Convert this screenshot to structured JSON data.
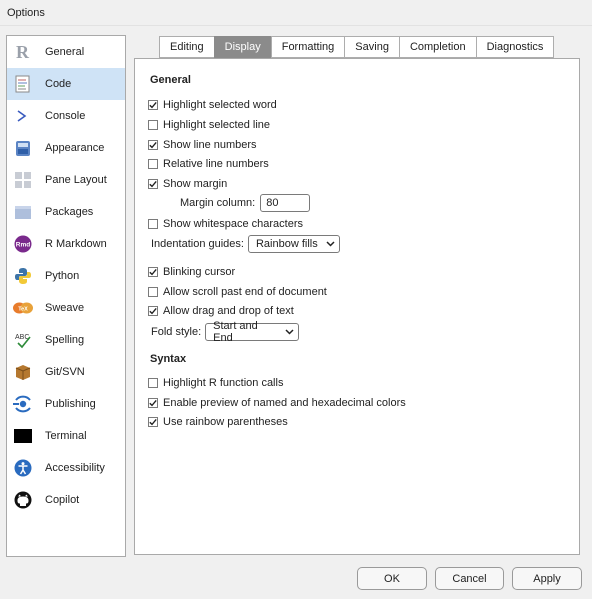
{
  "window": {
    "title": "Options"
  },
  "sidebar": {
    "items": [
      {
        "label": "General",
        "icon": "r-logo-icon"
      },
      {
        "label": "Code",
        "icon": "code-document-icon",
        "active": true
      },
      {
        "label": "Console",
        "icon": "console-prompt-icon"
      },
      {
        "label": "Appearance",
        "icon": "appearance-paint-icon"
      },
      {
        "label": "Pane Layout",
        "icon": "pane-layout-icon"
      },
      {
        "label": "Packages",
        "icon": "packages-box-icon"
      },
      {
        "label": "R Markdown",
        "icon": "rmarkdown-icon"
      },
      {
        "label": "Python",
        "icon": "python-logo-icon"
      },
      {
        "label": "Sweave",
        "icon": "sweave-tex-icon"
      },
      {
        "label": "Spelling",
        "icon": "spelling-abc-icon"
      },
      {
        "label": "Git/SVN",
        "icon": "git-box-icon"
      },
      {
        "label": "Publishing",
        "icon": "publishing-icon"
      },
      {
        "label": "Terminal",
        "icon": "terminal-icon"
      },
      {
        "label": "Accessibility",
        "icon": "accessibility-icon"
      },
      {
        "label": "Copilot",
        "icon": "github-copilot-icon"
      }
    ]
  },
  "tabs": [
    {
      "label": "Editing"
    },
    {
      "label": "Display",
      "active": true
    },
    {
      "label": "Formatting"
    },
    {
      "label": "Saving"
    },
    {
      "label": "Completion"
    },
    {
      "label": "Diagnostics"
    }
  ],
  "general": {
    "heading": "General",
    "highlight_word": {
      "label": "Highlight selected word",
      "checked": true
    },
    "highlight_line": {
      "label": "Highlight selected line",
      "checked": false
    },
    "show_line_numbers": {
      "label": "Show line numbers",
      "checked": true
    },
    "relative_line_numbers": {
      "label": "Relative line numbers",
      "checked": false
    },
    "show_margin": {
      "label": "Show margin",
      "checked": true
    },
    "margin_column": {
      "label": "Margin column:",
      "value": "80"
    },
    "show_whitespace": {
      "label": "Show whitespace characters",
      "checked": false
    },
    "indentation_guides": {
      "label": "Indentation guides:",
      "value": "Rainbow fills"
    },
    "blinking_cursor": {
      "label": "Blinking cursor",
      "checked": true
    },
    "scroll_past_end": {
      "label": "Allow scroll past end of document",
      "checked": false
    },
    "drag_drop": {
      "label": "Allow drag and drop of text",
      "checked": true
    },
    "fold_style": {
      "label": "Fold style:",
      "value": "Start and End"
    }
  },
  "syntax": {
    "heading": "Syntax",
    "highlight_r_calls": {
      "label": "Highlight R function calls",
      "checked": false
    },
    "preview_colors": {
      "label": "Enable preview of named and hexadecimal colors",
      "checked": true
    },
    "rainbow_parens": {
      "label": "Use rainbow parentheses",
      "checked": true
    }
  },
  "buttons": {
    "ok": "OK",
    "cancel": "Cancel",
    "apply": "Apply"
  },
  "colors": {
    "selected_sidebar": "#cfe3f6",
    "active_tab": "#8b8b8b"
  }
}
